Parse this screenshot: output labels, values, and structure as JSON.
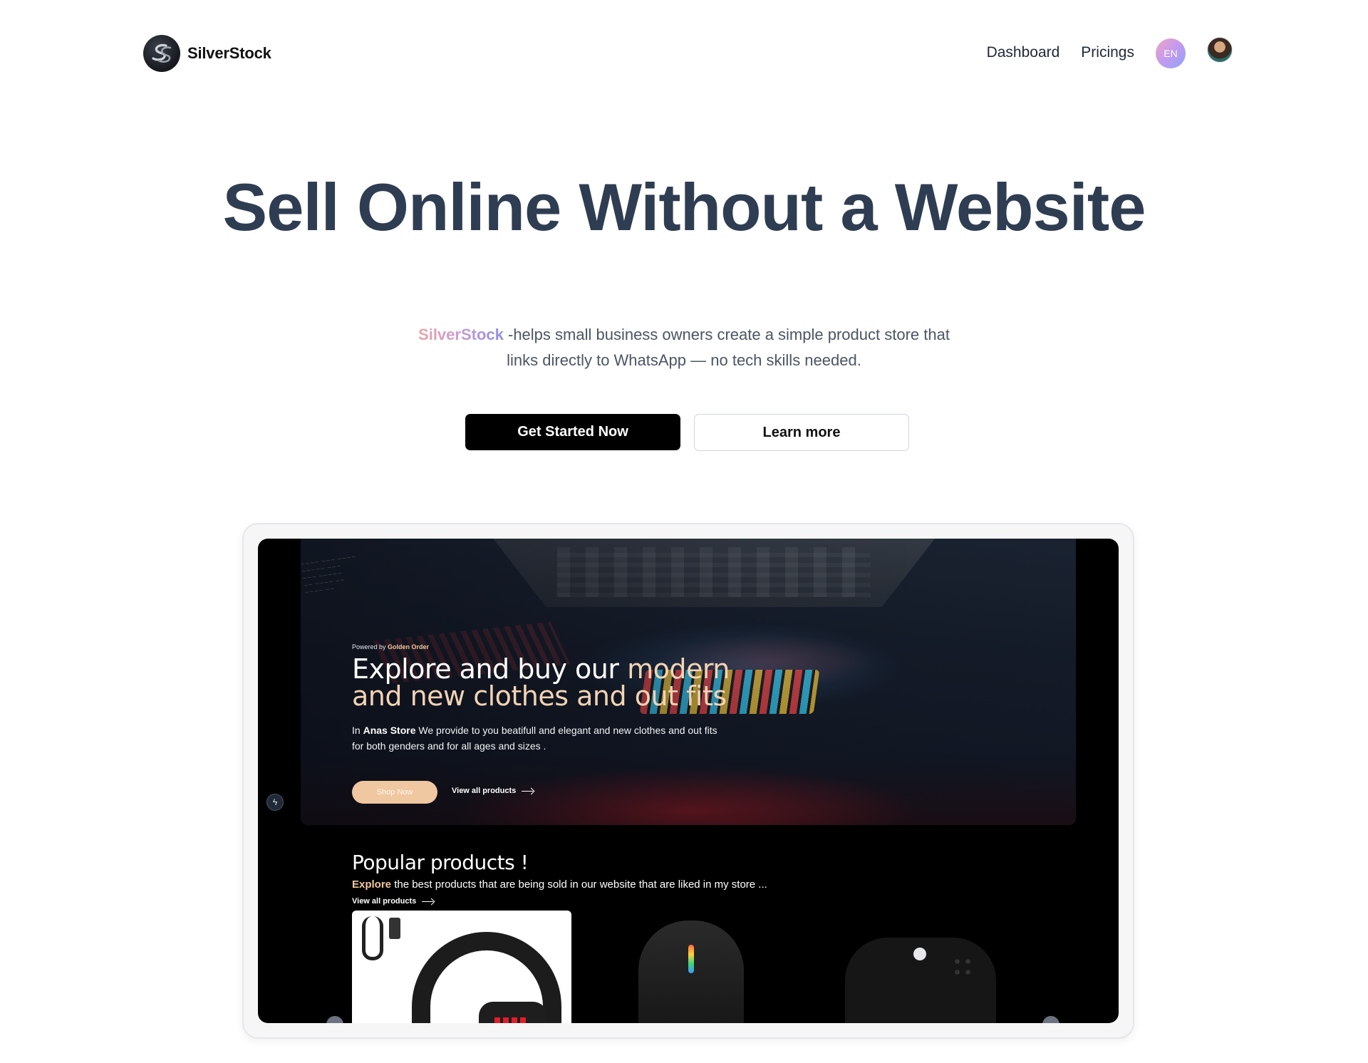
{
  "brand": {
    "name": "SilverStock",
    "logo_icon": "ss-monogram-icon"
  },
  "nav": {
    "links": [
      "Dashboard",
      "Pricings"
    ],
    "language": "EN",
    "avatar_icon": "user-avatar"
  },
  "hero": {
    "title": "Sell Online Without a Website",
    "subtitle_brand": "SilverStock",
    "subtitle_rest": " -helps small business owners create a simple product store that links directly to WhatsApp — no tech skills needed.",
    "primary_cta": "Get Started Now",
    "secondary_cta": "Learn more"
  },
  "preview": {
    "powered_prefix": "Powered by ",
    "powered_by": "Golden Order",
    "banner_title_plain": "Explore and buy our ",
    "banner_title_accent": "modern and new clothes and out fits",
    "banner_desc_prefix": "In ",
    "banner_desc_store": "Anas Store",
    "banner_desc_rest": " We provide to you beatifull and elegant and new clothes and out fits for both genders and for all ages and sizes .",
    "shop_button": "Shop Now",
    "view_all_banner": "View all products",
    "popular_title": "Popular products !",
    "popular_sub_accent": "Explore",
    "popular_sub_rest": " the best products that are being sold in our website that are liked in my store ...",
    "view_all_popular": "View all products",
    "bolt_icon": "bolt-icon",
    "products": [
      "headset-image",
      "mouse-image",
      "controller-image"
    ]
  },
  "colors": {
    "heading": "#2f3d52",
    "accent_peach": "#f2c89b",
    "primary_button": "#000000"
  }
}
